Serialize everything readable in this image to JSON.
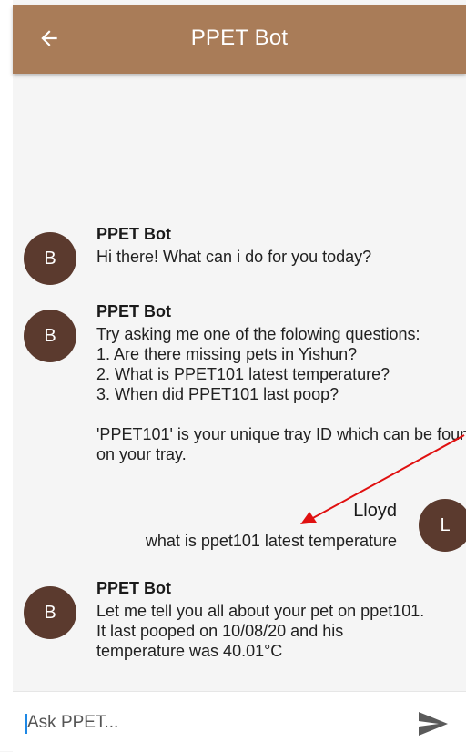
{
  "appbar": {
    "title": "PPET Bot",
    "back_icon": "arrow-left-icon"
  },
  "messages": [
    {
      "avatar": "B",
      "sender": "PPET Bot",
      "text": "Hi there! What can i do for you today?"
    },
    {
      "avatar": "B",
      "sender": "PPET Bot",
      "text": "Try asking me one of the folowing questions:\n1. Are there missing pets in Yishun?\n2. What is PPET101 latest temperature?\n3. When did PPET101 last poop?\n\n'PPET101' is your unique tray ID which can be found on your tray."
    },
    {
      "avatar": "B",
      "sender": "PPET Bot",
      "text": "Let me tell you all about your pet on ppet101.\nIt last pooped on 10/08/20 and his\ntemperature was 40.01°C"
    }
  ],
  "user_message": {
    "avatar": "L",
    "sender": "Lloyd",
    "text": "what is ppet101 latest temperature"
  },
  "input": {
    "placeholder": "Ask PPET...",
    "value": "",
    "send_icon": "send-icon"
  },
  "colors": {
    "appbar": "#a97c58",
    "avatar": "#5b3a2e",
    "annotation_arrow": "#e01010"
  }
}
